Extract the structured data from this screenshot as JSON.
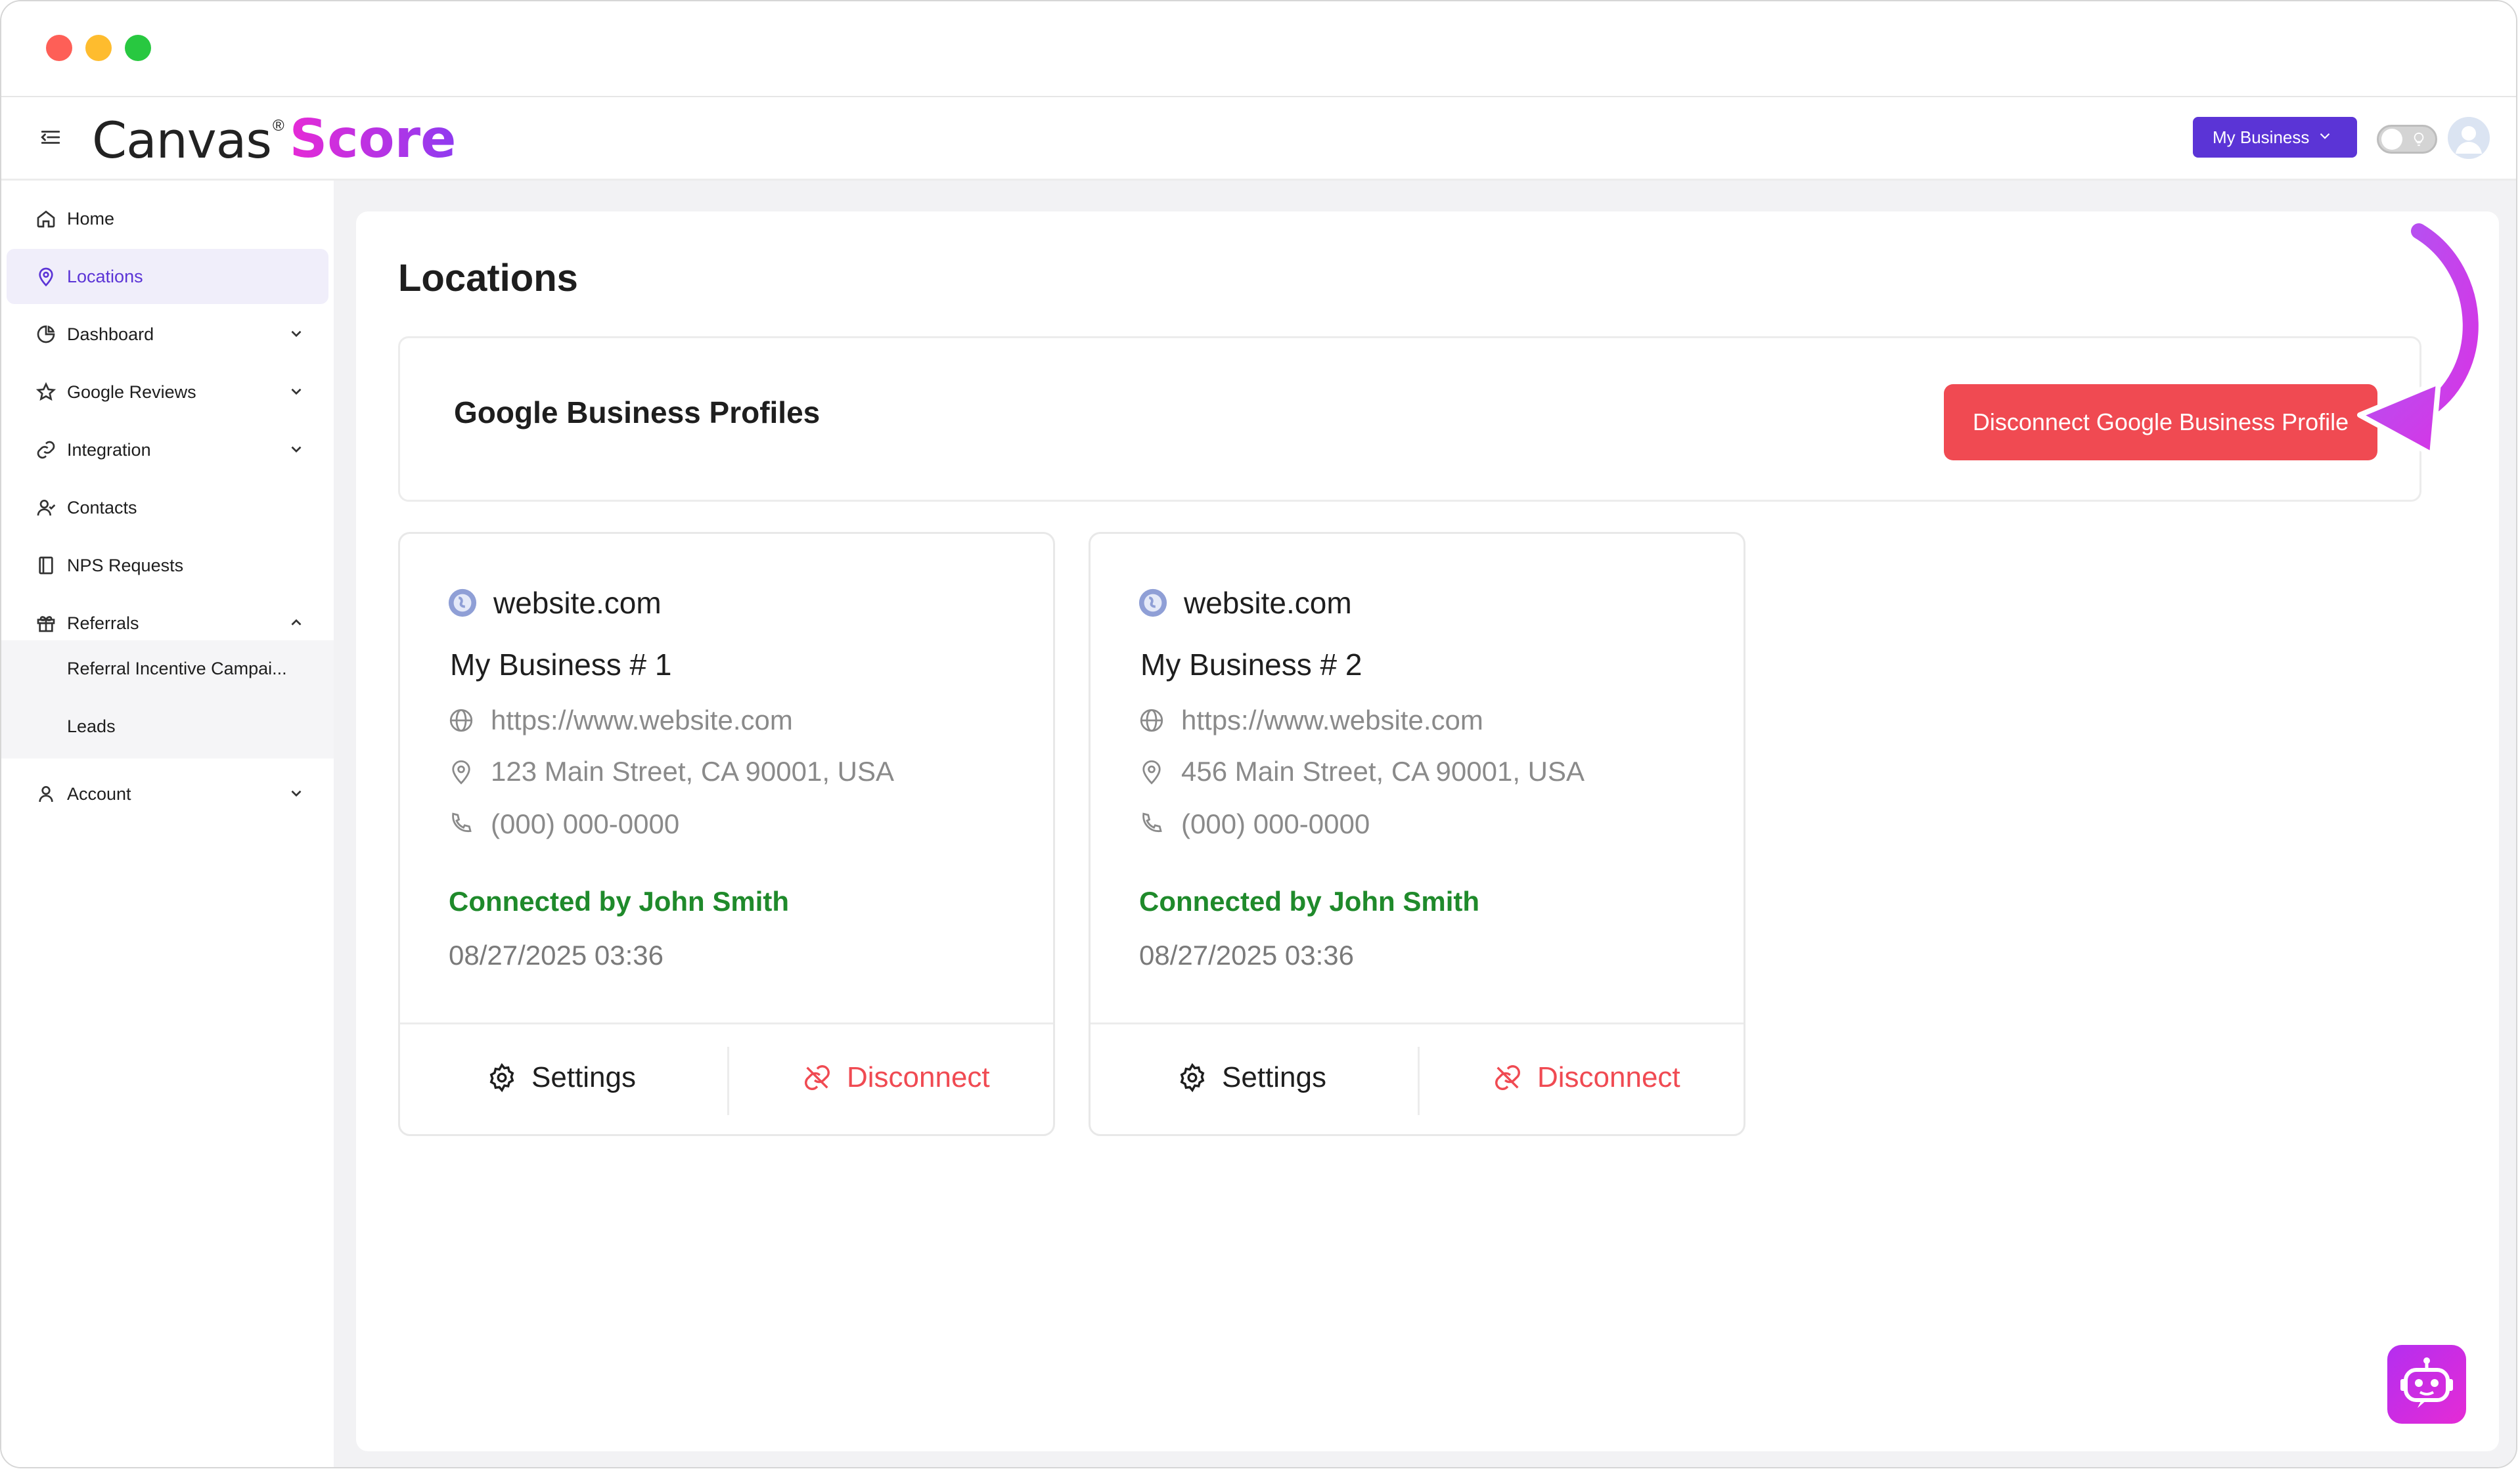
{
  "brand": {
    "logo_canvas": "Canvas",
    "logo_reg": "®",
    "logo_score": "Score"
  },
  "header": {
    "business_select": "My Business"
  },
  "sidebar": {
    "items": [
      {
        "label": "Home"
      },
      {
        "label": "Locations"
      },
      {
        "label": "Dashboard"
      },
      {
        "label": "Google Reviews"
      },
      {
        "label": "Integration"
      },
      {
        "label": "Contacts"
      },
      {
        "label": "NPS Requests"
      },
      {
        "label": "Referrals"
      },
      {
        "label": "Account"
      }
    ],
    "referral_sub": [
      {
        "label": "Referral Incentive Campai..."
      },
      {
        "label": "Leads"
      }
    ]
  },
  "page": {
    "title": "Locations"
  },
  "gbp": {
    "title": "Google Business Profiles",
    "disconnect_label": "Disconnect Google Business Profile"
  },
  "locations": [
    {
      "site": "website.com",
      "name": "My Business # 1",
      "url": "https://www.website.com",
      "address": "123 Main Street, CA 90001, USA",
      "phone": "(000) 000-0000",
      "connected": "Connected by John Smith",
      "timestamp": "08/27/2025 03:36",
      "settings_label": "Settings",
      "disconnect_label": "Disconnect"
    },
    {
      "site": "website.com",
      "name": "My Business # 2",
      "url": "https://www.website.com",
      "address": "456 Main Street, CA 90001, USA",
      "phone": "(000) 000-0000",
      "connected": "Connected by John Smith",
      "timestamp": "08/27/2025 03:36",
      "settings_label": "Settings",
      "disconnect_label": "Disconnect"
    }
  ],
  "colors": {
    "accent": "#5b34d6",
    "danger": "#f04a52",
    "success": "#1f8a2b"
  }
}
